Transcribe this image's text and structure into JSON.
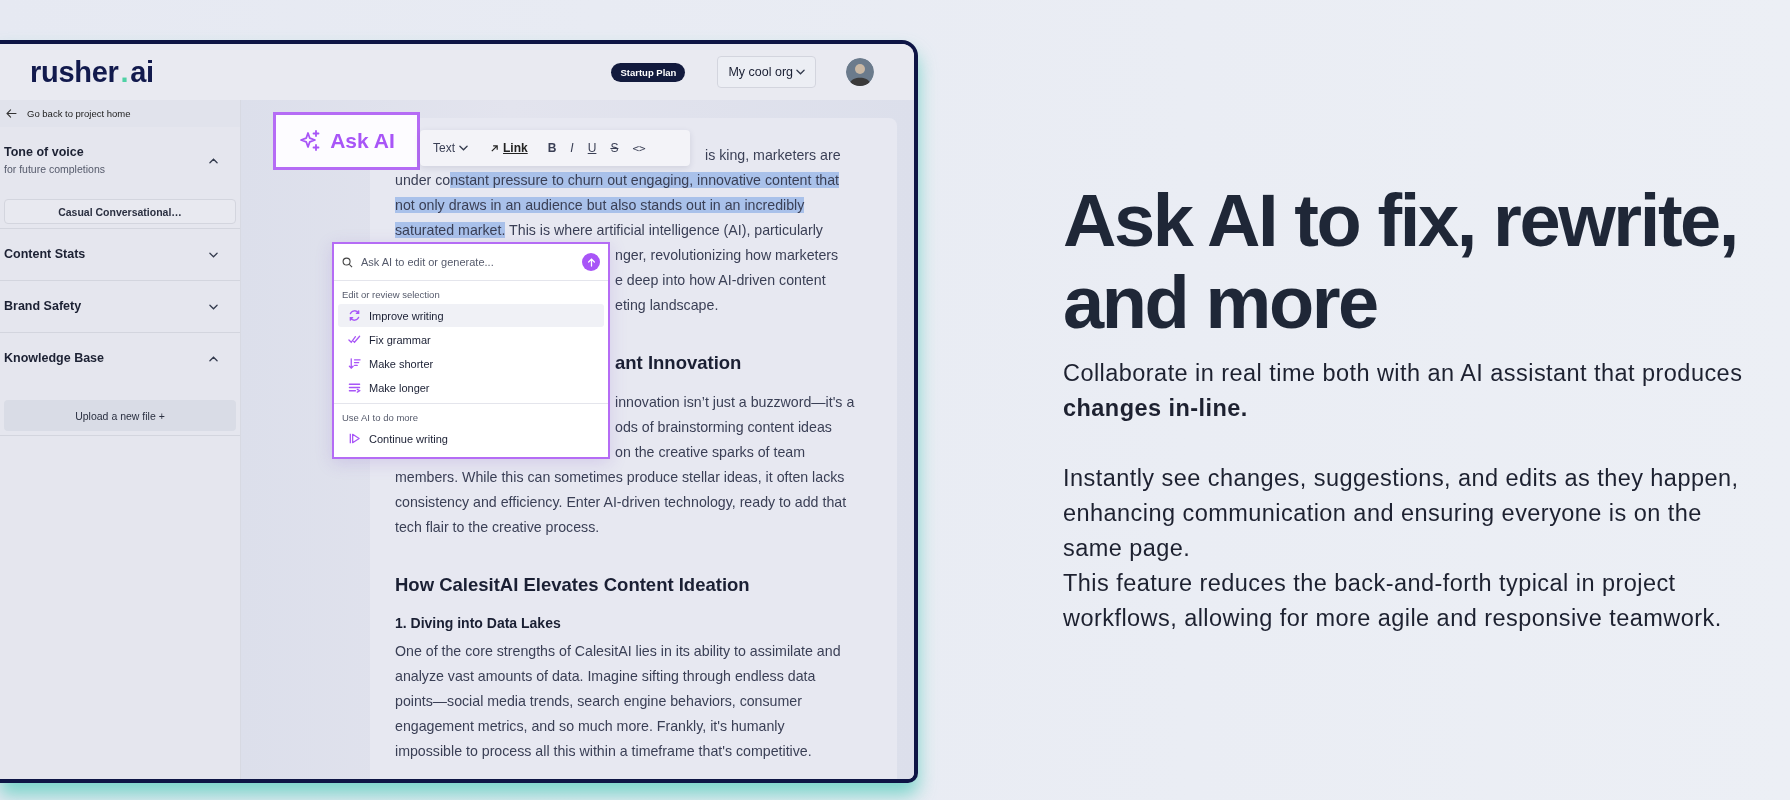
{
  "header": {
    "logo": [
      {
        "kind": "word",
        "text": "rusher"
      },
      {
        "kind": "dot",
        "text": "."
      },
      {
        "kind": "word",
        "text": "ai"
      }
    ],
    "plan_badge": "Startup Plan",
    "org_dropdown": "My cool org"
  },
  "sidebar": {
    "back_link": "Go back to project home",
    "sections": [
      {
        "title": "Tone of voice",
        "subtitle": "for future completions",
        "expanded": true,
        "dropdown": "Casual Conversational…"
      },
      {
        "title": "Content Stats",
        "expanded": false
      },
      {
        "title": "Brand Safety",
        "expanded": false
      },
      {
        "title": "Knowledge Base",
        "expanded": true,
        "button": "Upload a new file +"
      }
    ]
  },
  "ask_ai_button": "Ask AI",
  "toolbar": {
    "text_style": "Text",
    "buttons": [
      {
        "kind": "link",
        "label": "Link"
      },
      {
        "kind": "bold",
        "label": "B"
      },
      {
        "kind": "italic",
        "label": "I"
      },
      {
        "kind": "underline",
        "label": "U"
      },
      {
        "kind": "strike",
        "label": "S"
      },
      {
        "kind": "code",
        "label": "<>"
      }
    ]
  },
  "ai_menu": {
    "placeholder": "Ask AI to edit or generate...",
    "sections": [
      {
        "label": "Edit or review selection",
        "items": [
          {
            "kind": "improve",
            "label": "Improve writing",
            "selected": true
          },
          {
            "kind": "grammar",
            "label": "Fix grammar",
            "selected": false
          },
          {
            "kind": "shorter",
            "label": "Make shorter",
            "selected": false
          },
          {
            "kind": "longer",
            "label": "Make longer",
            "selected": false
          }
        ]
      },
      {
        "label": "Use AI to do more",
        "items": [
          {
            "kind": "continue",
            "label": "Continue writing",
            "selected": false
          }
        ]
      }
    ]
  },
  "document": {
    "blocks": [
      {
        "kind": "paragraph",
        "lines": [
          {
            "kind": "after_toolbar",
            "segments": [
              {
                "text": "is king, marketers are",
                "selected": false
              }
            ]
          },
          {
            "kind": "full",
            "segments": [
              {
                "text": "under co",
                "selected": false
              },
              {
                "text": "nstant pressure to churn out engaging, innovative content that",
                "selected": true
              }
            ]
          },
          {
            "kind": "full",
            "segments": [
              {
                "text": "not only draws in an audience but also stands out in an incredibly",
                "selected": true
              }
            ]
          },
          {
            "kind": "full",
            "segments": [
              {
                "text": "saturated market.",
                "selected": true
              },
              {
                "text": " This is where artificial intelligence (AI), particularly",
                "selected": false
              }
            ]
          },
          {
            "kind": "after_popup",
            "segments": [
              {
                "text": "nger, revolutionizing how marketers",
                "selected": false
              }
            ]
          },
          {
            "kind": "after_popup",
            "segments": [
              {
                "text": "e deep into how AI-driven content",
                "selected": false
              }
            ]
          },
          {
            "kind": "after_popup",
            "segments": [
              {
                "text": "eting landscape.",
                "selected": false
              }
            ]
          }
        ]
      },
      {
        "kind": "heading",
        "lines": [
          {
            "kind": "after_popup",
            "text": "ant Innovation"
          }
        ]
      },
      {
        "kind": "paragraph",
        "lines": [
          {
            "kind": "after_popup",
            "segments": [
              {
                "text": "innovation isn’t just a buzzword—it's a",
                "selected": false
              }
            ]
          },
          {
            "kind": "after_popup",
            "segments": [
              {
                "text": "ods of brainstorming content ideas",
                "selected": false
              }
            ]
          },
          {
            "kind": "after_popup",
            "segments": [
              {
                "text": "on the creative sparks of team",
                "selected": false
              }
            ]
          },
          {
            "kind": "full",
            "segments": [
              {
                "text": "members. While this can sometimes produce stellar ideas, it often lacks",
                "selected": false
              }
            ]
          },
          {
            "kind": "full",
            "segments": [
              {
                "text": "consistency and efficiency. Enter AI-driven technology, ready to add that",
                "selected": false
              }
            ]
          },
          {
            "kind": "full",
            "segments": [
              {
                "text": "tech flair to the creative process.",
                "selected": false
              }
            ]
          }
        ]
      },
      {
        "kind": "heading",
        "lines": [
          {
            "kind": "full",
            "text": "How CalesitAI Elevates Content Ideation"
          }
        ]
      },
      {
        "kind": "subheading",
        "lines": [
          {
            "kind": "full",
            "text": "1. Diving into Data Lakes"
          }
        ]
      },
      {
        "kind": "paragraph",
        "lines": [
          {
            "kind": "full",
            "segments": [
              {
                "text": "One of the core strengths of CalesitAI lies in its ability to assimilate and",
                "selected": false
              }
            ]
          },
          {
            "kind": "full",
            "segments": [
              {
                "text": "analyze vast amounts of data. Imagine sifting through endless data",
                "selected": false
              }
            ]
          },
          {
            "kind": "full",
            "segments": [
              {
                "text": "points—social media trends, search engine behaviors, consumer",
                "selected": false
              }
            ]
          },
          {
            "kind": "full",
            "segments": [
              {
                "text": "engagement metrics, and so much more. Frankly, it's humanly",
                "selected": false
              }
            ]
          },
          {
            "kind": "full",
            "segments": [
              {
                "text": "impossible to process all this within a timeframe that's competitive.",
                "selected": false
              }
            ]
          }
        ]
      }
    ]
  },
  "hero": {
    "title": "Ask AI to fix, rewrite, and more",
    "paragraphs": [
      "Collaborate in real time both with an AI assistant that produces **changes in-line.**",
      "Instantly see changes, suggestions, and edits as they happen, enhancing communication and ensuring everyone is on the same page.",
      "This feature reduces the back-and-forth typical in project workflows, allowing for more agile and responsive teamwork."
    ]
  }
}
